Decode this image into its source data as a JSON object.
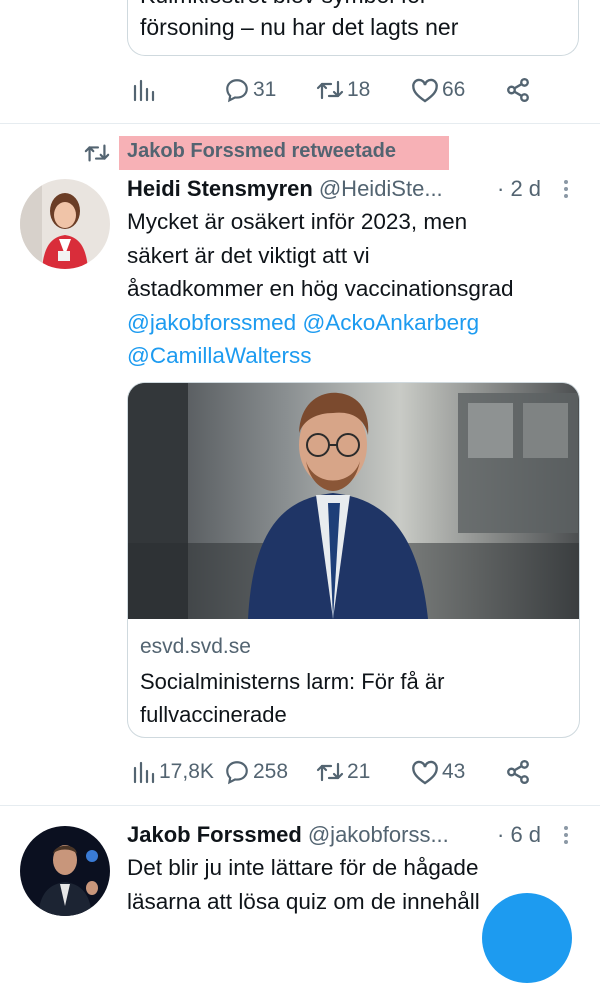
{
  "prev_tweet": {
    "text_line1": "Kulmkiostret blev symbol för",
    "text_line2": "försoning – nu har det lagts ner",
    "actions": {
      "views": "",
      "replies": "31",
      "retweets": "18",
      "likes": "66"
    }
  },
  "retweet_banner": {
    "text": "Jakob Forssmed retweetade"
  },
  "tweet1": {
    "name": "Heidi Stensmyren",
    "handle": "@HeidiSte...",
    "time": "· 2 d",
    "line1": "Mycket är osäkert inför 2023, men",
    "line2": "säkert är det viktigt att vi",
    "line3": "åstadkommer en hög vaccinationsgrad",
    "mention1": "@jakobforssmed",
    "mention2": "@AckoAnkarberg",
    "mention3": "@CamillaWalterss",
    "card": {
      "domain": "esvd.svd.se",
      "title": "Socialministerns larm: För få är fullvaccinerade"
    },
    "actions": {
      "views": "17,8K",
      "replies": "258",
      "retweets": "21",
      "likes": "43"
    }
  },
  "tweet2": {
    "name": "Jakob Forssmed",
    "handle": "@jakobforss...",
    "time": "· 6 d",
    "line1": "Det blir ju inte lättare för de hågade",
    "line2": "läsarna att lösa quiz om de innehåll"
  },
  "icons": {
    "views": "bar-chart-icon",
    "reply": "speech-bubble-icon",
    "retweet": "retweet-icon",
    "like": "heart-icon",
    "share": "share-icon",
    "more": "more-dots-icon"
  },
  "colors": {
    "accent": "#1d9bf0",
    "secondary_text": "#536471",
    "highlight": "#f7b1b6"
  }
}
